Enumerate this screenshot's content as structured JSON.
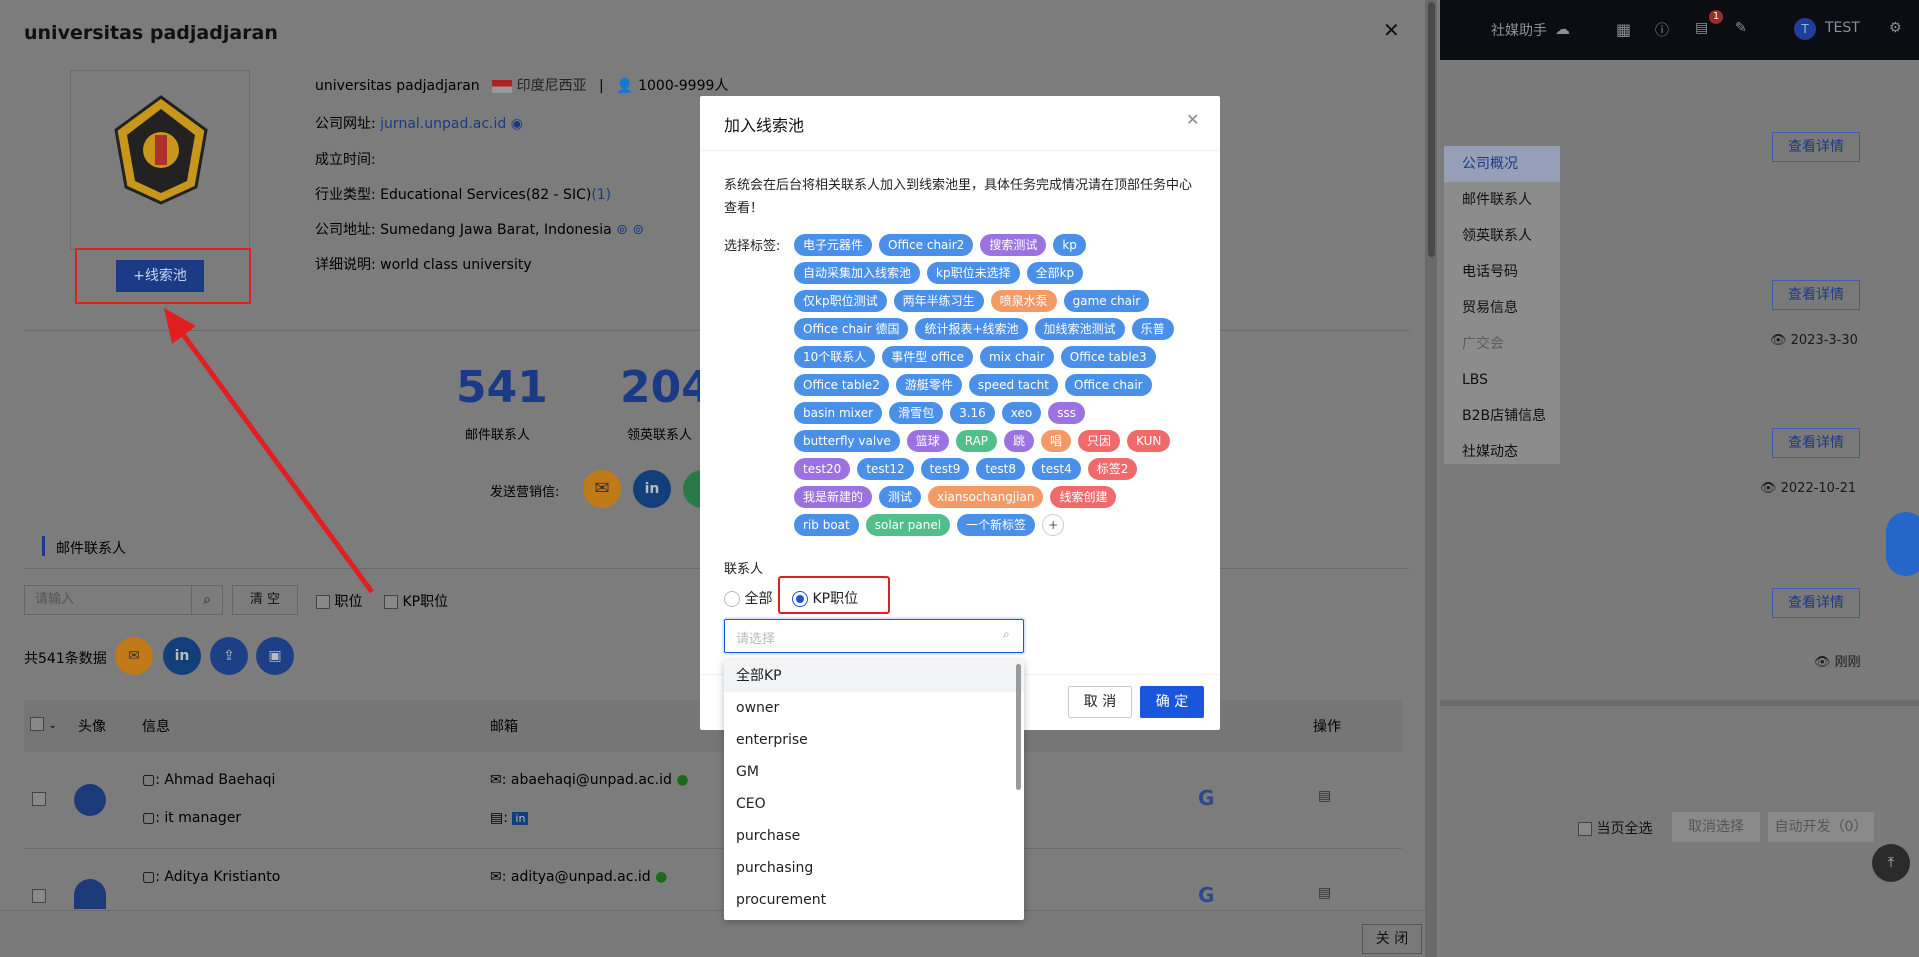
{
  "topbar": {
    "assistant": "社媒助手",
    "user": "TEST",
    "avatar_letter": "T",
    "badge": "1"
  },
  "bg": {
    "detail_btn": "查看详情",
    "dates": [
      "2023-3-30",
      "2022-10-21",
      "刚刚"
    ],
    "select_all": "当页全选",
    "cancel_select": "取消选择",
    "auto_dev": "自动开发（0）"
  },
  "sidemenu": [
    "公司概况",
    "邮件联系人",
    "领英联系人",
    "电话号码",
    "贸易信息",
    "广交会",
    "LBS",
    "B2B店铺信息",
    "社媒动态"
  ],
  "drawer": {
    "title": "universitas padjadjaran",
    "company": "universitas padjadjaran",
    "country": "印度尼西亚",
    "employees": "1000-9999人",
    "site_label": "公司网址:",
    "site": "jurnal.unpad.ac.id",
    "founded_label": "成立时间:",
    "industry_label": "行业类型:",
    "industry": "Educational Services(82 - SIC)",
    "industry_count": "(1)",
    "address_label": "公司地址:",
    "address": "Sumedang Jawa Barat, Indonesia",
    "desc_label": "详细说明:",
    "desc": "world class university",
    "add_pool": "+线索池",
    "stat1_num": "541",
    "stat1_label": "邮件联系人",
    "stat2_num": "204",
    "stat2_label": "领英联系人",
    "send_label": "发送营销信:",
    "section": "邮件联系人",
    "search_placeholder": "请输入",
    "clear": "清 空",
    "cb1": "职位",
    "cb2": "KP职位",
    "total": "共541条数据",
    "cols": {
      "avatar": "头像",
      "info": "信息",
      "email": "邮箱",
      "ops": "操作"
    },
    "rows": [
      {
        "name": "Ahmad Baehaqi",
        "title": "it manager",
        "email": "abaehaqi@unpad.ac.id"
      },
      {
        "name": "Aditya Kristianto",
        "title": "",
        "email": "aditya@unpad.ac.id"
      }
    ],
    "close": "关 闭"
  },
  "modal": {
    "title": "加入线索池",
    "notice": "系统会在后台将相关联系人加入到线索池里，具体任务完成情况请在顶部任务中心查看！",
    "tags_label": "选择标签:",
    "tags": [
      [
        {
          "t": "电子元器件",
          "c": "blue"
        },
        {
          "t": "Office chair2",
          "c": "blue"
        },
        {
          "t": "搜索测试",
          "c": "purple"
        },
        {
          "t": "kp",
          "c": "blue"
        }
      ],
      [
        {
          "t": "自动采集加入线索池",
          "c": "blue"
        },
        {
          "t": "kp职位未选择",
          "c": "blue"
        },
        {
          "t": "全部kp",
          "c": "blue"
        }
      ],
      [
        {
          "t": "仅kp职位测试",
          "c": "blue"
        },
        {
          "t": "两年半练习生",
          "c": "blue"
        },
        {
          "t": "喷泉水泵",
          "c": "orange"
        },
        {
          "t": "game chair",
          "c": "blue"
        }
      ],
      [
        {
          "t": "Office chair 德国",
          "c": "blue"
        },
        {
          "t": "统计报表+线索池",
          "c": "blue"
        },
        {
          "t": "加线索池测试",
          "c": "blue"
        },
        {
          "t": "乐普",
          "c": "blue"
        }
      ],
      [
        {
          "t": "10个联系人",
          "c": "blue"
        },
        {
          "t": "事件型 office",
          "c": "blue"
        },
        {
          "t": "mix chair",
          "c": "blue"
        },
        {
          "t": "Office table3",
          "c": "blue"
        }
      ],
      [
        {
          "t": "Office table2",
          "c": "blue"
        },
        {
          "t": "游艇零件",
          "c": "blue"
        },
        {
          "t": "speed tacht",
          "c": "blue"
        },
        {
          "t": "Office chair",
          "c": "blue"
        }
      ],
      [
        {
          "t": "basin mixer",
          "c": "blue"
        },
        {
          "t": "滑雪包",
          "c": "blue"
        },
        {
          "t": "3.16",
          "c": "blue"
        },
        {
          "t": "xeo",
          "c": "blue"
        },
        {
          "t": "sss",
          "c": "purple"
        }
      ],
      [
        {
          "t": "butterfly valve",
          "c": "blue"
        },
        {
          "t": "篮球",
          "c": "purple"
        },
        {
          "t": "RAP",
          "c": "green"
        },
        {
          "t": "跳",
          "c": "purple"
        },
        {
          "t": "唱",
          "c": "orange"
        },
        {
          "t": "只因",
          "c": "redt"
        },
        {
          "t": "KUN",
          "c": "redt"
        }
      ],
      [
        {
          "t": "test20",
          "c": "purple"
        },
        {
          "t": "test12",
          "c": "blue"
        },
        {
          "t": "test9",
          "c": "blue"
        },
        {
          "t": "test8",
          "c": "blue"
        },
        {
          "t": "test4",
          "c": "blue"
        },
        {
          "t": "标签2",
          "c": "redt"
        }
      ],
      [
        {
          "t": "我是新建的",
          "c": "purple"
        },
        {
          "t": "测试",
          "c": "blue"
        },
        {
          "t": "xiansochangjian",
          "c": "orange"
        },
        {
          "t": "线索创建",
          "c": "redt"
        }
      ],
      [
        {
          "t": "rib boat",
          "c": "blue"
        },
        {
          "t": "solar panel",
          "c": "green"
        },
        {
          "t": "一个新标签",
          "c": "blue"
        }
      ]
    ],
    "add_tag": "+",
    "contact_label": "联系人",
    "radio_all": "全部",
    "radio_kp": "KP职位",
    "select_placeholder": "请选择",
    "cancel": "取 消",
    "ok": "确 定"
  },
  "dropdown": [
    "全部KP",
    "owner",
    "enterprise",
    "GM",
    "CEO",
    "purchase",
    "purchasing",
    "procurement"
  ]
}
